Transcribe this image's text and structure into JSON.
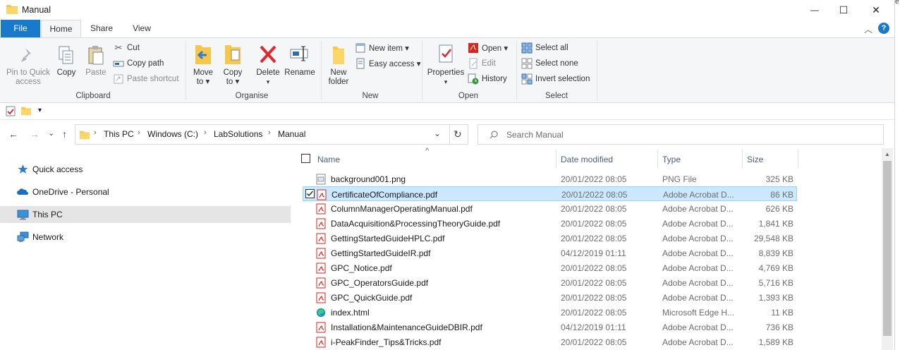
{
  "window": {
    "title": "Manual",
    "controls": {
      "minimize": "—",
      "maximize": "☐",
      "close": "✕"
    },
    "edge_letter": "e"
  },
  "ribbon_tabs": {
    "file": "File",
    "home": "Home",
    "share": "Share",
    "view": "View",
    "help": "?"
  },
  "ribbon": {
    "clipboard": {
      "label": "Clipboard",
      "pin_line1": "Pin to Quick",
      "pin_line2": "access",
      "copy": "Copy",
      "paste": "Paste",
      "cut": "Cut",
      "copy_path": "Copy path",
      "paste_shortcut": "Paste shortcut"
    },
    "organise": {
      "label": "Organise",
      "move_to_line1": "Move",
      "move_to_line2": "to ▾",
      "copy_to_line1": "Copy",
      "copy_to_line2": "to ▾",
      "delete": "Delete",
      "delete_arrow": "▾",
      "rename": "Rename"
    },
    "new": {
      "label": "New",
      "new_folder_line1": "New",
      "new_folder_line2": "folder",
      "new_item": "New item ▾",
      "easy_access": "Easy access ▾"
    },
    "open": {
      "label": "Open",
      "properties": "Properties",
      "properties_arrow": "▾",
      "open": "Open ▾",
      "edit": "Edit",
      "history": "History"
    },
    "select": {
      "label": "Select",
      "select_all": "Select all",
      "select_none": "Select none",
      "invert_selection": "Invert selection"
    }
  },
  "qat": {
    "dropdown": "▾"
  },
  "address": {
    "back": "←",
    "forward": "→",
    "recent": "⌄",
    "up": "↑",
    "crumbs": [
      "This PC",
      "Windows (C:)",
      "LabSolutions",
      "Manual"
    ],
    "separator": "›",
    "dropdown": "⌄",
    "refresh": "↻",
    "search_placeholder": "Search Manual"
  },
  "nav": [
    {
      "label": "Quick access",
      "icon": "star-icon"
    },
    {
      "label": "OneDrive - Personal",
      "icon": "cloud-icon"
    },
    {
      "label": "This PC",
      "icon": "computer-icon",
      "selected": true
    },
    {
      "label": "Network",
      "icon": "network-icon"
    }
  ],
  "columns": {
    "name": "Name",
    "date": "Date modified",
    "type": "Type",
    "size": "Size",
    "sort_arrow": "^"
  },
  "files": [
    {
      "name": "background001.png",
      "date": "20/01/2022 08:05",
      "type": "PNG File",
      "size": "325 KB",
      "icon": "png"
    },
    {
      "name": "CertificateOfCompliance.pdf",
      "date": "20/01/2022 08:05",
      "type": "Adobe Acrobat D...",
      "size": "86 KB",
      "icon": "pdf",
      "selected": true
    },
    {
      "name": "ColumnManagerOperatingManual.pdf",
      "date": "20/01/2022 08:05",
      "type": "Adobe Acrobat D...",
      "size": "626 KB",
      "icon": "pdf"
    },
    {
      "name": "DataAcquisition&ProcessingTheoryGuide.pdf",
      "date": "20/01/2022 08:05",
      "type": "Adobe Acrobat D...",
      "size": "1,841 KB",
      "icon": "pdf"
    },
    {
      "name": "GettingStartedGuideHPLC.pdf",
      "date": "20/01/2022 08:05",
      "type": "Adobe Acrobat D...",
      "size": "29,548 KB",
      "icon": "pdf"
    },
    {
      "name": "GettingStartedGuideIR.pdf",
      "date": "04/12/2019 01:11",
      "type": "Adobe Acrobat D...",
      "size": "8,839 KB",
      "icon": "pdf"
    },
    {
      "name": "GPC_Notice.pdf",
      "date": "20/01/2022 08:05",
      "type": "Adobe Acrobat D...",
      "size": "4,769 KB",
      "icon": "pdf"
    },
    {
      "name": "GPC_OperatorsGuide.pdf",
      "date": "20/01/2022 08:05",
      "type": "Adobe Acrobat D...",
      "size": "5,716 KB",
      "icon": "pdf"
    },
    {
      "name": "GPC_QuickGuide.pdf",
      "date": "20/01/2022 08:05",
      "type": "Adobe Acrobat D...",
      "size": "1,393 KB",
      "icon": "pdf"
    },
    {
      "name": "index.html",
      "date": "20/01/2022 08:05",
      "type": "Microsoft Edge H...",
      "size": "11 KB",
      "icon": "edge"
    },
    {
      "name": "Installation&MaintenanceGuideDBIR.pdf",
      "date": "04/12/2019 01:11",
      "type": "Adobe Acrobat D...",
      "size": "736 KB",
      "icon": "pdf"
    },
    {
      "name": "i-PeakFinder_Tips&Tricks.pdf",
      "date": "20/01/2022 08:05",
      "type": "Adobe Acrobat D...",
      "size": "1,589 KB",
      "icon": "pdf"
    }
  ],
  "colors": {
    "file_tab": "#1979ca",
    "selection": "#cce8ff",
    "selection_border": "#99d1ff",
    "nav_selected": "#e5e5e5",
    "pdf_red": "#d9251d",
    "folder_yellow": "#f8c74a"
  }
}
